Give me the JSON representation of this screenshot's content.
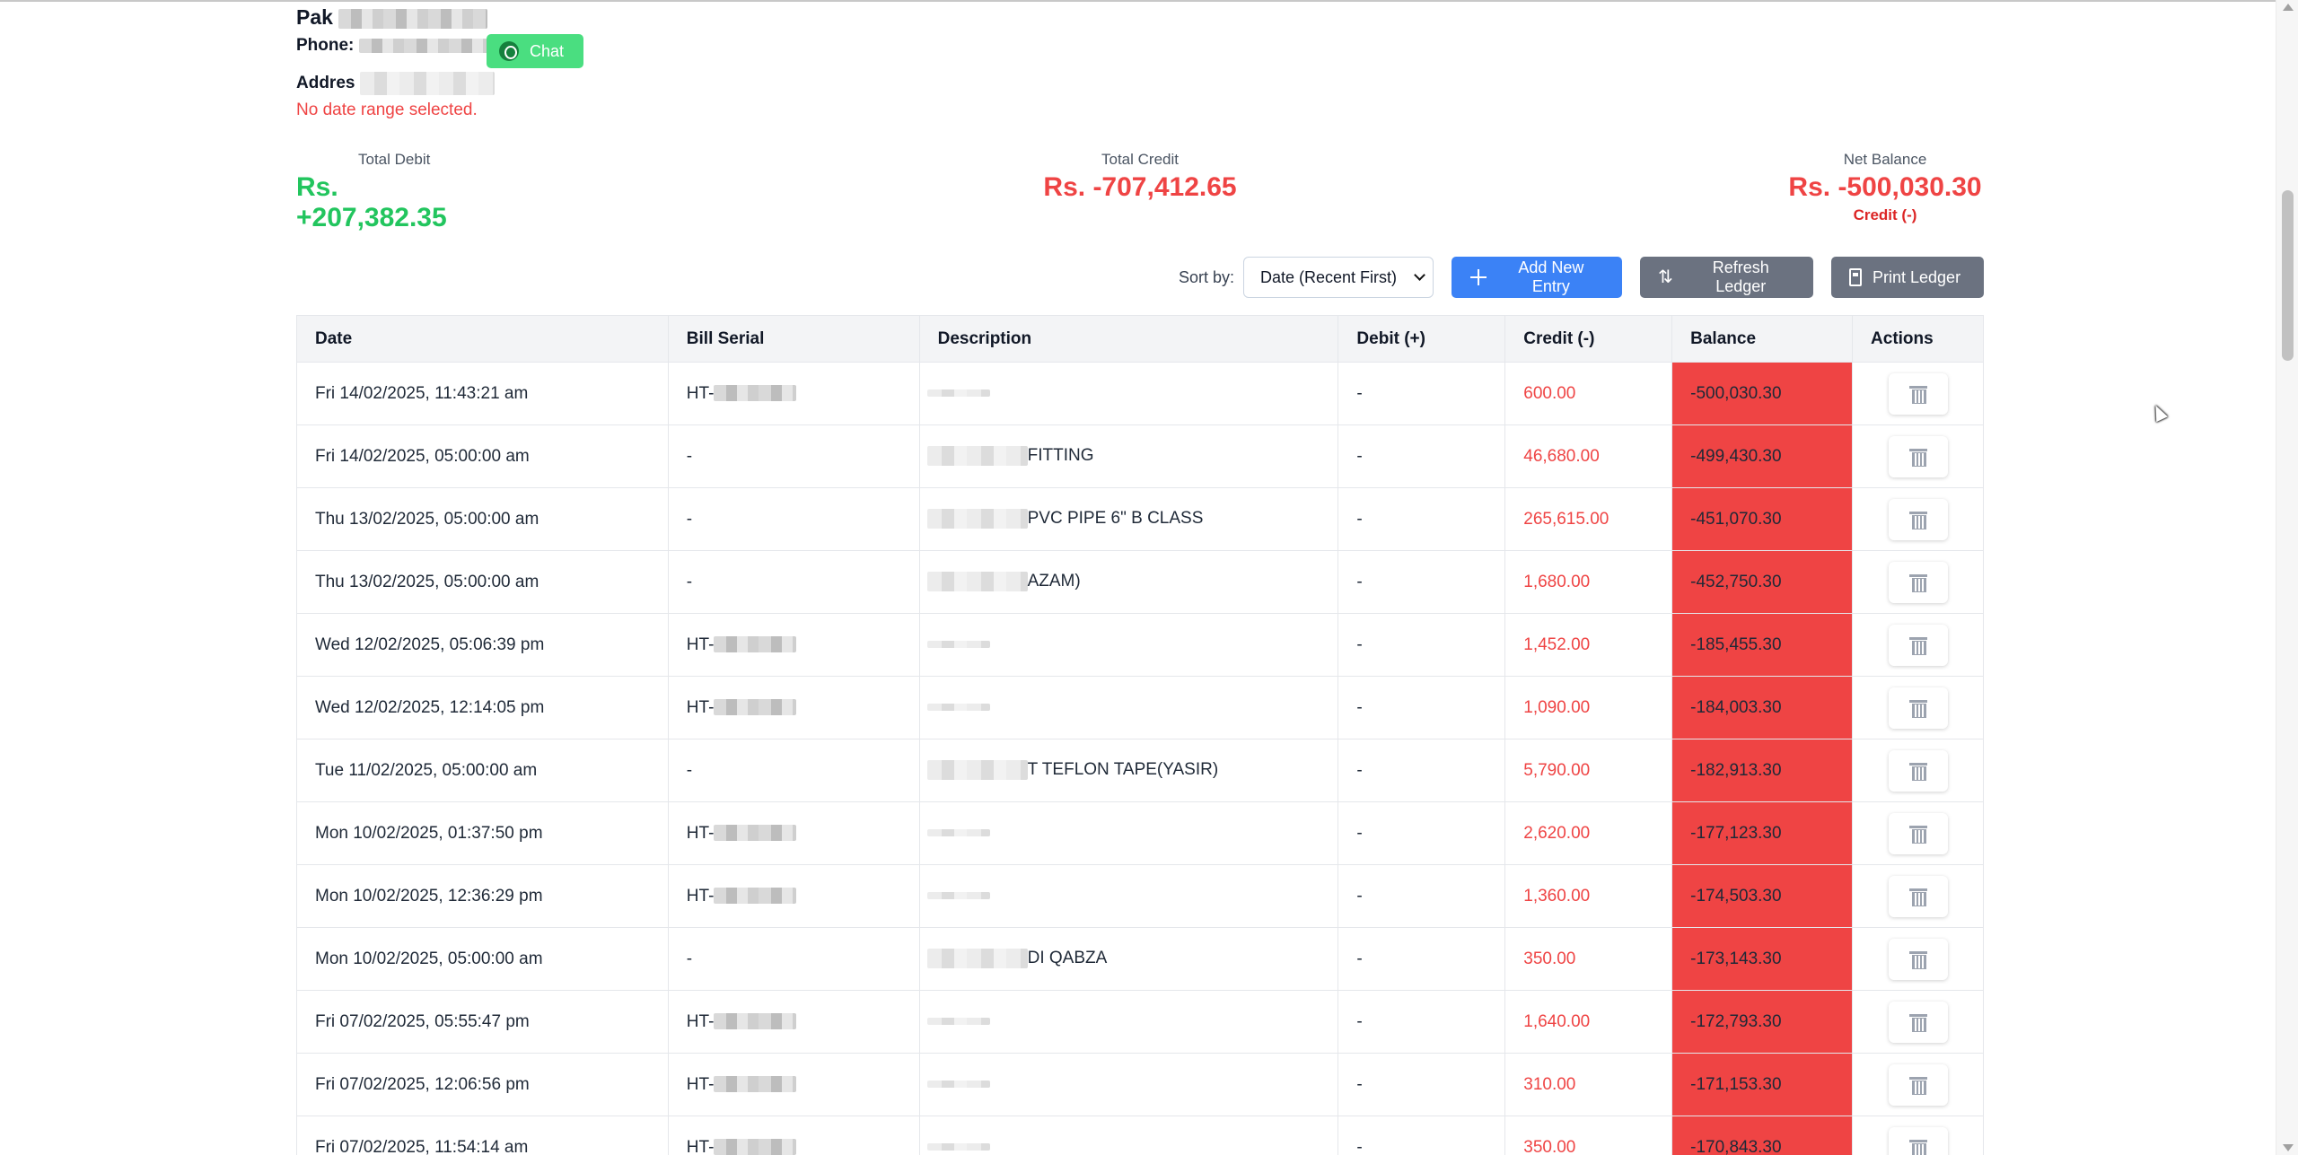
{
  "customer": {
    "name": "Pak",
    "phone_label": "Phone:",
    "address_label": "Addres",
    "chat_label": "Chat",
    "date_range_message": "No date range selected."
  },
  "summary": {
    "total_debit_label": "Total Debit",
    "total_debit": "Rs. +207,382.35",
    "total_credit_label": "Total Credit",
    "total_credit": "Rs. -707,412.65",
    "net_balance_label": "Net Balance",
    "net_balance": "Rs. -500,030.30",
    "net_balance_type": "Credit (-)",
    "colors": {
      "debit": "#22c55e",
      "credit": "#ef4444"
    }
  },
  "toolbar": {
    "sort_label": "Sort by:",
    "sort_value": "Date (Recent First)",
    "add_label": "Add New Entry",
    "refresh_label": "Refresh Ledger",
    "print_label": "Print Ledger"
  },
  "table": {
    "headers": [
      "Date",
      "Bill Serial",
      "Description",
      "Debit (+)",
      "Credit (-)",
      "Balance",
      "Actions"
    ],
    "rows": [
      {
        "date": "Fri 14/02/2025, 11:43:21 am",
        "bill": "HT-",
        "desc": "",
        "debit": "-",
        "credit": "600.00",
        "balance": "-500,030.30"
      },
      {
        "date": "Fri 14/02/2025, 05:00:00 am",
        "bill": "-",
        "desc": "FITTING",
        "debit": "-",
        "credit": "46,680.00",
        "balance": "-499,430.30"
      },
      {
        "date": "Thu 13/02/2025, 05:00:00 am",
        "bill": "-",
        "desc": "PVC PIPE 6\" B CLASS",
        "debit": "-",
        "credit": "265,615.00",
        "balance": "-451,070.30"
      },
      {
        "date": "Thu 13/02/2025, 05:00:00 am",
        "bill": "-",
        "desc": "AZAM)",
        "debit": "-",
        "credit": "1,680.00",
        "balance": "-452,750.30"
      },
      {
        "date": "Wed 12/02/2025, 05:06:39 pm",
        "bill": "HT-",
        "desc": "",
        "debit": "-",
        "credit": "1,452.00",
        "balance": "-185,455.30"
      },
      {
        "date": "Wed 12/02/2025, 12:14:05 pm",
        "bill": "HT-",
        "desc": "",
        "debit": "-",
        "credit": "1,090.00",
        "balance": "-184,003.30"
      },
      {
        "date": "Tue 11/02/2025, 05:00:00 am",
        "bill": "-",
        "desc": "T TEFLON TAPE(YASIR)",
        "debit": "-",
        "credit": "5,790.00",
        "balance": "-182,913.30"
      },
      {
        "date": "Mon 10/02/2025, 01:37:50 pm",
        "bill": "HT-",
        "desc": "",
        "debit": "-",
        "credit": "2,620.00",
        "balance": "-177,123.30"
      },
      {
        "date": "Mon 10/02/2025, 12:36:29 pm",
        "bill": "HT-",
        "desc": "",
        "debit": "-",
        "credit": "1,360.00",
        "balance": "-174,503.30"
      },
      {
        "date": "Mon 10/02/2025, 05:00:00 am",
        "bill": "-",
        "desc": "DI QABZA",
        "debit": "-",
        "credit": "350.00",
        "balance": "-173,143.30"
      },
      {
        "date": "Fri 07/02/2025, 05:55:47 pm",
        "bill": "HT-",
        "desc": "",
        "debit": "-",
        "credit": "1,640.00",
        "balance": "-172,793.30"
      },
      {
        "date": "Fri 07/02/2025, 12:06:56 pm",
        "bill": "HT-",
        "desc": "",
        "debit": "-",
        "credit": "310.00",
        "balance": "-171,153.30"
      },
      {
        "date": "Fri 07/02/2025, 11:54:14 am",
        "bill": "HT-",
        "desc": "",
        "debit": "-",
        "credit": "350.00",
        "balance": "-170,843.30"
      }
    ],
    "action_icon": "trash-icon"
  }
}
